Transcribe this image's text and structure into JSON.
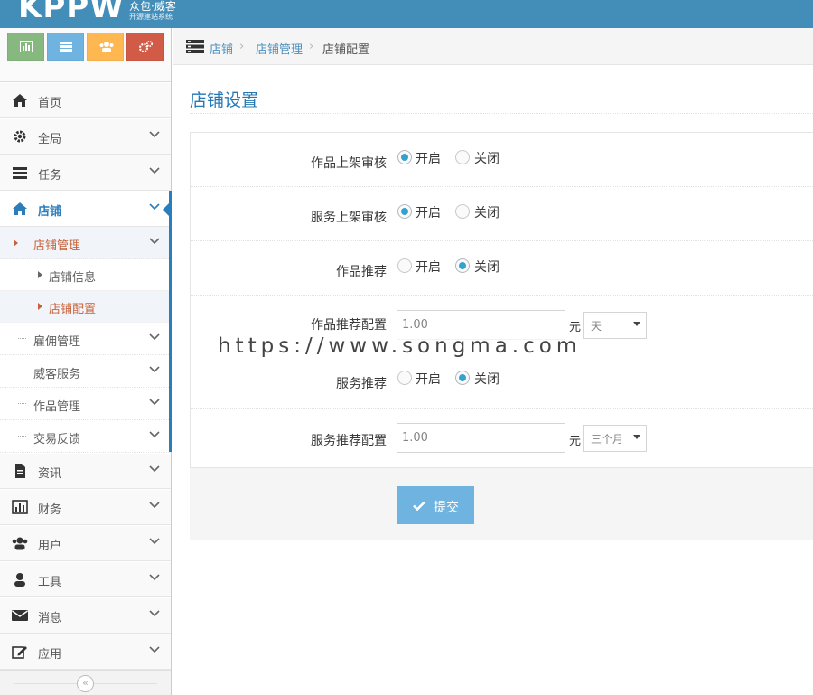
{
  "brand": {
    "logo": "KPPW",
    "name": "众包·威客",
    "tagline": "开源建站系统",
    "color": "#438eb9"
  },
  "shortcuts": [
    {
      "icon": "bar-chart-icon",
      "color": "#87b87f"
    },
    {
      "icon": "list-icon",
      "color": "#6fb3e0"
    },
    {
      "icon": "users-icon",
      "color": "#ffb752"
    },
    {
      "icon": "cogs-icon",
      "color": "#d15b47"
    }
  ],
  "sidebar": {
    "items": [
      {
        "label": "首页",
        "icon": "home-icon"
      },
      {
        "label": "全局",
        "icon": "gear-icon"
      },
      {
        "label": "任务",
        "icon": "list-icon"
      },
      {
        "label": "店铺",
        "icon": "home-icon",
        "active": true
      },
      {
        "label": "资讯",
        "icon": "file-icon"
      },
      {
        "label": "财务",
        "icon": "bar-chart-icon"
      },
      {
        "label": "用户",
        "icon": "users-icon"
      },
      {
        "label": "工具",
        "icon": "user-icon"
      },
      {
        "label": "消息",
        "icon": "envelope-icon"
      },
      {
        "label": "应用",
        "icon": "edit-icon"
      }
    ],
    "shop_sub": [
      {
        "label": "店铺管理",
        "open": true
      },
      {
        "label": "店铺信息"
      },
      {
        "label": "店铺配置",
        "selected": true
      },
      {
        "label": "雇佣管理"
      },
      {
        "label": "威客服务"
      },
      {
        "label": "作品管理"
      },
      {
        "label": "交易反馈"
      }
    ],
    "collapse_glyph": "«"
  },
  "breadcrumb": {
    "items": [
      "店铺",
      "店铺管理",
      "店铺配置"
    ],
    "separator": "›"
  },
  "page": {
    "title": "店铺设置"
  },
  "form": {
    "rows": [
      {
        "label": "作品上架审核",
        "type": "radio",
        "options": [
          "开启",
          "关闭"
        ],
        "selected": "开启"
      },
      {
        "label": "服务上架审核",
        "type": "radio",
        "options": [
          "开启",
          "关闭"
        ],
        "selected": "开启"
      },
      {
        "label": "作品推荐",
        "type": "radio",
        "options": [
          "开启",
          "关闭"
        ],
        "selected": "关闭"
      },
      {
        "label": "作品推荐配置",
        "type": "price",
        "value": "1.00",
        "unit": "元",
        "period": "天"
      },
      {
        "label": "服务推荐",
        "type": "radio",
        "options": [
          "开启",
          "关闭"
        ],
        "selected": "关闭"
      },
      {
        "label": "服务推荐配置",
        "type": "price",
        "value": "1.00",
        "unit": "元",
        "period": "三个月"
      }
    ],
    "submit_label": "提交"
  },
  "watermark": "https://www.songma.com",
  "colors": {
    "active_blue": "#2b7dbc",
    "link_blue": "#4c8fbd",
    "title_blue": "#2679b5",
    "submenu_active": "#c86139",
    "radio_on": "#32a3ce",
    "button": "#6fb3e0"
  }
}
